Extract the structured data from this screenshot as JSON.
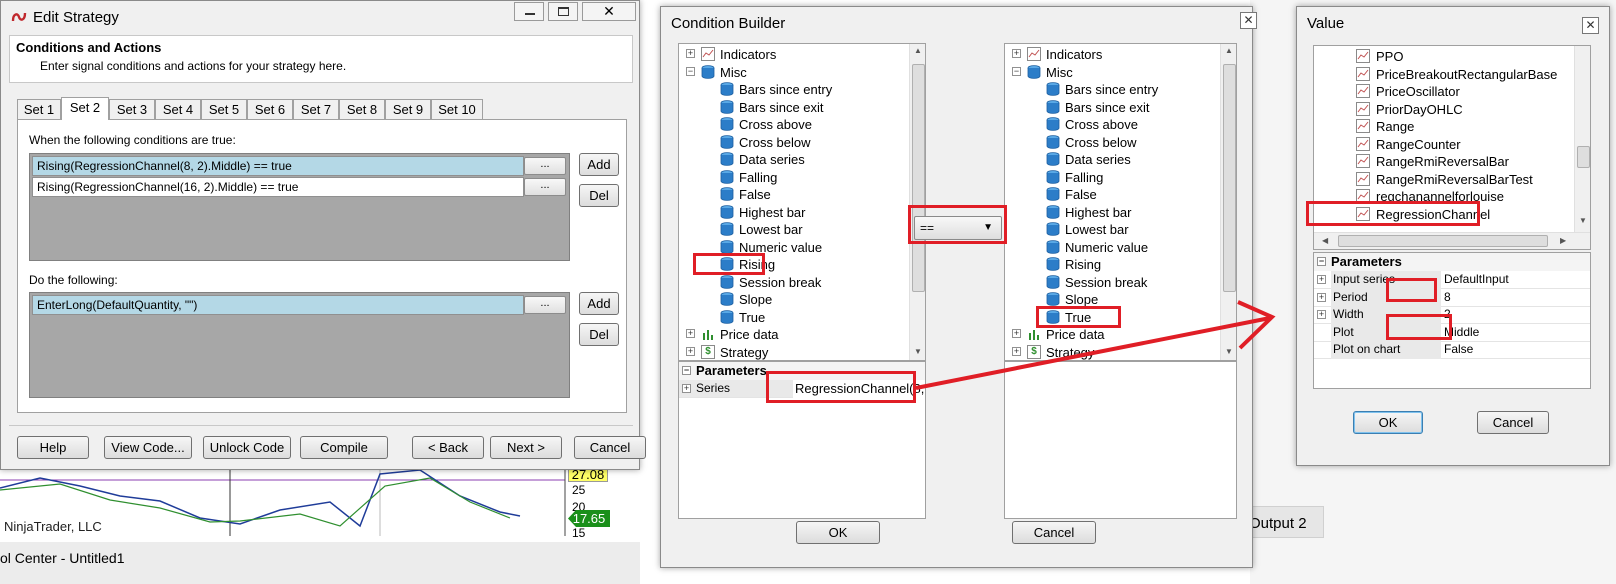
{
  "edit_strategy": {
    "title": "Edit Strategy",
    "section_title": "Conditions and Actions",
    "section_subtitle": "Enter signal conditions and actions for your strategy here.",
    "tabs": [
      "Set 1",
      "Set 2",
      "Set 3",
      "Set 4",
      "Set 5",
      "Set 6",
      "Set 7",
      "Set 8",
      "Set 9",
      "Set 10"
    ],
    "active_tab": "Set 2",
    "conditions_label": "When the following conditions are true:",
    "conditions": [
      "Rising(RegressionChannel(8, 2).Middle) == true",
      "Rising(RegressionChannel(16, 2).Middle) == true"
    ],
    "actions_label": "Do the following:",
    "actions": [
      "EnterLong(DefaultQuantity, \"\")"
    ],
    "ellipsis": "...",
    "add_label": "Add",
    "del_label": "Del",
    "buttons": {
      "help": "Help",
      "view_code": "View Code...",
      "unlock_code": "Unlock Code",
      "compile": "Compile",
      "back": "< Back",
      "next": "Next >",
      "cancel": "Cancel"
    }
  },
  "background": {
    "price_top": "27.08",
    "price_current": "17.65",
    "axis_25": "25",
    "axis_20": "20",
    "axis_15": "15",
    "watermark": "NinjaTrader, LLC",
    "taskbar_title": "ol Center - Untitled1",
    "output_tab": "Output 2"
  },
  "condition_builder": {
    "title": "Condition Builder",
    "operator": "==",
    "left_tree": {
      "groups": [
        "Indicators",
        "Misc",
        "Price data",
        "Strategy"
      ],
      "items": [
        "Bars since entry",
        "Bars since exit",
        "Cross above",
        "Cross below",
        "Data series",
        "Falling",
        "False",
        "Highest bar",
        "Lowest bar",
        "Numeric value",
        "Rising",
        "Session break",
        "Slope",
        "True"
      ]
    },
    "right_tree": {
      "groups": [
        "Indicators",
        "Misc",
        "Price data",
        "Strategy"
      ],
      "items": [
        "Bars since entry",
        "Bars since exit",
        "Cross above",
        "Cross below",
        "Data series",
        "Falling",
        "False",
        "Highest bar",
        "Lowest bar",
        "Numeric value",
        "Rising",
        "Session break",
        "Slope",
        "True"
      ]
    },
    "params_header": "Parameters",
    "series_label": "Series",
    "series_value": "RegressionChannel(8,",
    "ok": "OK",
    "cancel": "Cancel"
  },
  "value_dialog": {
    "title": "Value",
    "indicators": [
      "PPO",
      "PriceBreakoutRectangularBase",
      "PriceOscillator",
      "PriorDayOHLC",
      "Range",
      "RangeCounter",
      "RangeRmiReversalBar",
      "RangeRmiReversalBarTest",
      "regchanannelforlouise",
      "RegressionChannel"
    ],
    "params_header": "Parameters",
    "params": [
      {
        "name": "Input series",
        "value": "DefaultInput"
      },
      {
        "name": "Period",
        "value": "8"
      },
      {
        "name": "Width",
        "value": "2"
      },
      {
        "name": "Plot",
        "value": "Middle"
      },
      {
        "name": "Plot on chart",
        "value": "False"
      }
    ],
    "ok": "OK",
    "cancel": "Cancel"
  },
  "colors": {
    "highlight": "#b4d8e6",
    "red_annotation": "#e01e26",
    "list_gray": "#a7a7a7",
    "price_yellow": "#ffff66",
    "price_green": "#1a8f1a"
  }
}
